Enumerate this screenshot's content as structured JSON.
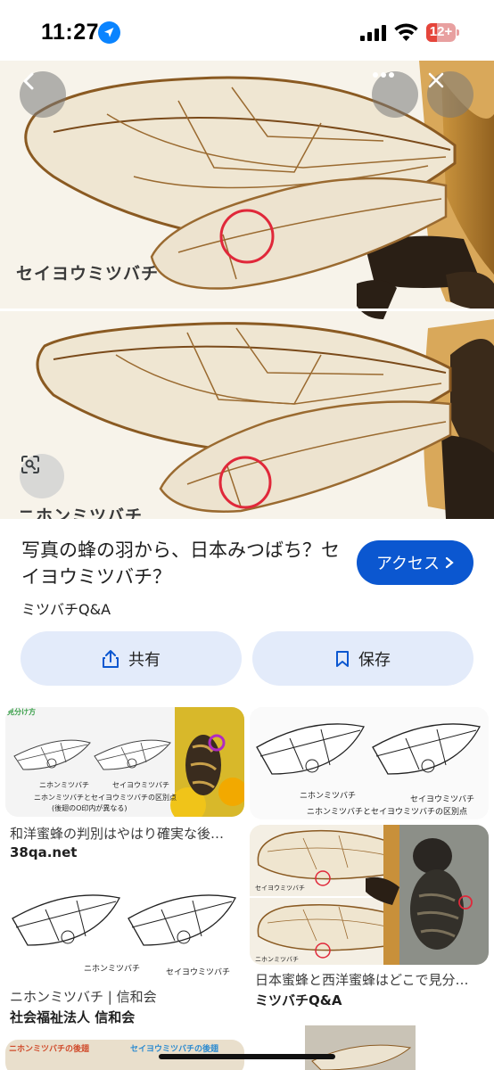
{
  "status_bar": {
    "time": "11:27",
    "battery": "12+"
  },
  "hero": {
    "label_top": "セイヨウミツバチ",
    "label_bottom": "ニホンミツバチ"
  },
  "result": {
    "title": "写真の蜂の羽から、日本みつばち？セイヨウミツバチ？",
    "access_label": "アクセス",
    "source": "ミツバチQ&A",
    "share_label": "共有",
    "save_label": "保存"
  },
  "grid": {
    "card1": {
      "badge": "見分け方",
      "left_label": "ニホンミツバチ",
      "right_label": "セイヨウミツバチ",
      "note1": "ニホンミツバチとセイヨウミツバチの区別点",
      "note2": "(後翅のO印内が異なる)",
      "caption": "和洋蜜蜂の判別はやはり確実な後…",
      "source": "38qa.net"
    },
    "card2": {
      "left_label": "ニホンミツバチ",
      "right_label": "セイヨウミツバチ",
      "note": "ニホンミツバチとセイヨウミツバチの区別点"
    },
    "card3": {
      "left_label": "ニホンミツバチ",
      "right_label": "セイヨウミツバチ",
      "caption": "ニホンミツバチ | 信和会",
      "source": "社会福祉法人 信和会"
    },
    "card4": {
      "top_label": "セイヨウミツバチ",
      "bottom_label": "ニホンミツバチ",
      "caption": "日本蜜蜂と西洋蜜蜂はどこで見分…",
      "source": "ミツバチQ&A"
    },
    "card5": {
      "left_label": "ニホンミツバチの後翅",
      "right_label": "セイヨウミツバチの後翅"
    }
  }
}
